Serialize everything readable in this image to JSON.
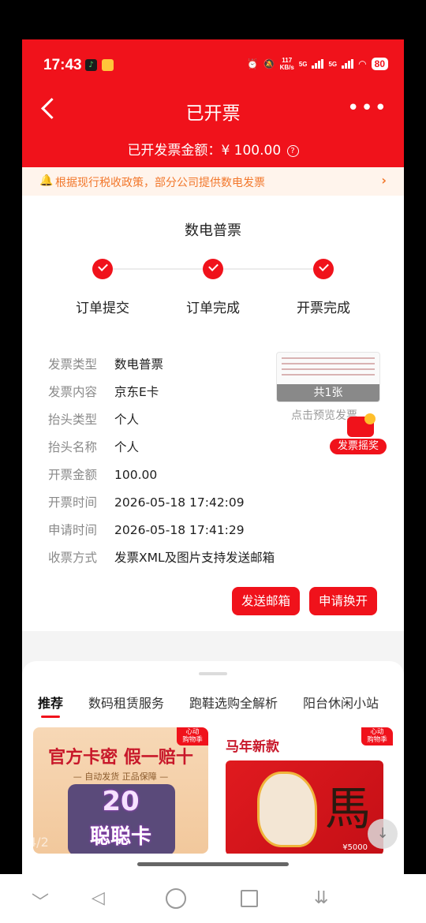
{
  "status_bar": {
    "time": "17:43",
    "net_speed_top": "117",
    "net_speed_unit": "KB/s",
    "sim1": "5G",
    "sim2": "5G",
    "battery": "80"
  },
  "nav": {
    "back_icon": "chevron-left-icon",
    "title": "已开票",
    "more_icon": "more-dots-icon",
    "more_glyph": "•••"
  },
  "summary": {
    "amount_label": "已开发票金额：",
    "amount_value": "¥ 100.00",
    "help_icon": "question-circle-icon",
    "help_glyph": "?"
  },
  "notice": {
    "icon": "bell-icon",
    "text": "根据现行税收政策，部分公司提供数电发票",
    "arrow": "›"
  },
  "invoice": {
    "type_title": "数电普票",
    "steps": [
      {
        "label": "订单提交"
      },
      {
        "label": "订单完成"
      },
      {
        "label": "开票完成"
      }
    ],
    "fields": [
      {
        "key": "发票类型",
        "value": "数电普票"
      },
      {
        "key": "发票内容",
        "value": "京东E卡"
      },
      {
        "key": "抬头类型",
        "value": "个人"
      },
      {
        "key": "抬头名称",
        "value": "个人"
      },
      {
        "key": "开票金额",
        "value": "100.00"
      },
      {
        "key": "开票时间",
        "value": "2026-05-18 17:42:09"
      },
      {
        "key": "申请时间",
        "value": "2026-05-18 17:41:29"
      },
      {
        "key": "收票方式",
        "value": "发票XML及图片支持发送邮箱"
      }
    ],
    "preview_count": "共1张",
    "preview_hint": "点击预览发票",
    "lottery_label": "发票摇奖",
    "send_email_button": "发送邮箱",
    "reissue_button": "申请换开"
  },
  "recommend": {
    "tabs": [
      "推荐",
      "数码租赁服务",
      "跑鞋选购全解析",
      "阳台休闲小站"
    ],
    "products": [
      {
        "badge": "心动\n购物季",
        "title": "官方卡密 假一赔十",
        "subtitle": "— 自动发货 正品保障 —",
        "number": "20",
        "name": "聪聪卡"
      },
      {
        "badge": "心动\n购物季",
        "title": "马年新款",
        "image_char": "馬",
        "price_note": "¥5000"
      }
    ],
    "page_indicator": "4/2",
    "download_icon": "download-arrow-icon",
    "download_glyph": "↓"
  },
  "system_nav": {
    "collapse_glyph": "﹀",
    "back_glyph": "◁",
    "extra_glyph": "⇊"
  }
}
